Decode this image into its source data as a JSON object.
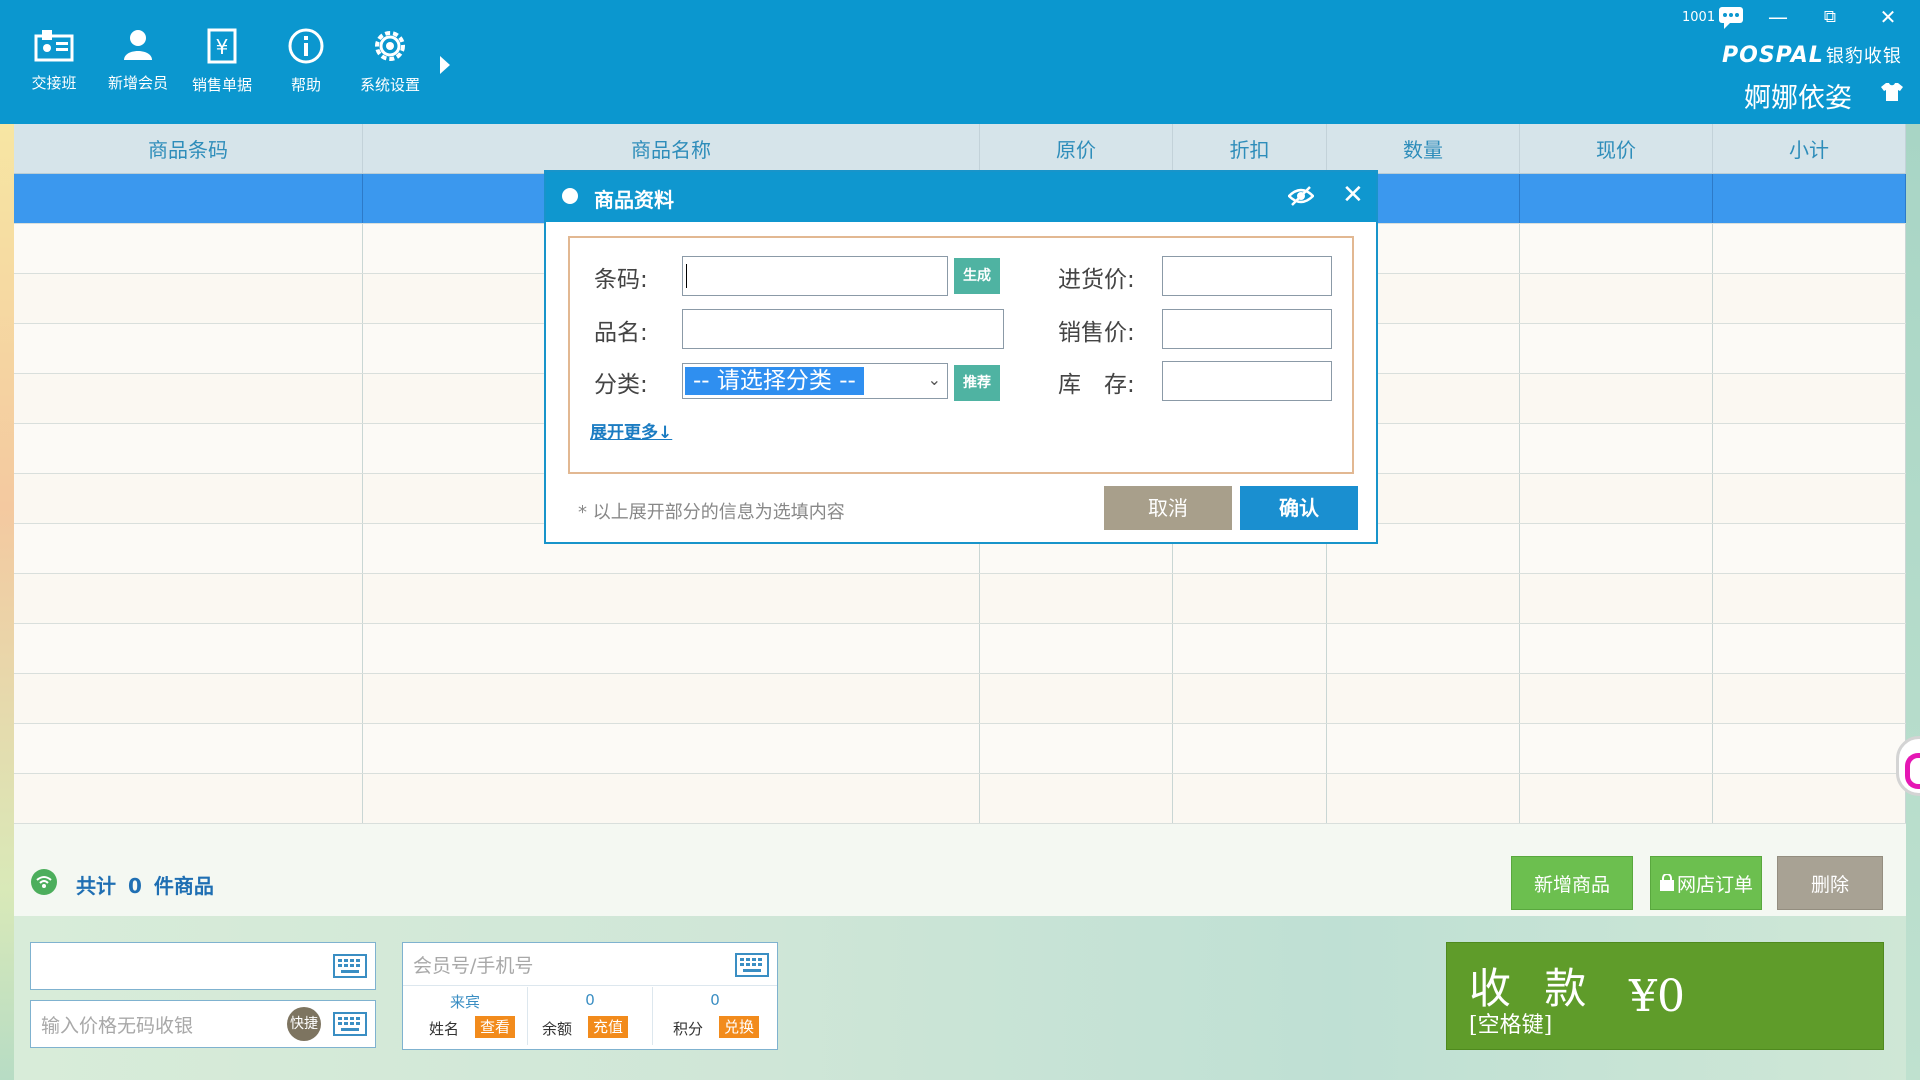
{
  "toolbar": {
    "items": [
      {
        "label": "交接班",
        "icon": "shift-handover-icon"
      },
      {
        "label": "新增会员",
        "icon": "add-member-icon"
      },
      {
        "label": "销售单据",
        "icon": "sales-receipt-icon"
      },
      {
        "label": "帮助",
        "icon": "help-icon"
      },
      {
        "label": "系统设置",
        "icon": "settings-icon"
      }
    ]
  },
  "window": {
    "account": "1001",
    "brand_logo": "POSPAL",
    "brand_sub": "银豹收银",
    "store_name": "婀娜依姿",
    "minimize": "—",
    "restore": "⧉",
    "close": "✕"
  },
  "table": {
    "columns": [
      "商品条码",
      "商品名称",
      "原价",
      "折扣",
      "数量",
      "现价",
      "小计"
    ],
    "row_count": 13
  },
  "summary": {
    "prefix": "共计",
    "count": "0",
    "suffix": "件商品",
    "btn_add_product": "新增商品",
    "btn_online_orders": "网店订单",
    "btn_delete": "删除"
  },
  "bottom": {
    "price_input_placeholder": "输入价格无码收银",
    "quick_badge": "快捷",
    "member_placeholder": "会员号/手机号",
    "member": {
      "name_value": "来宾",
      "name_label": "姓名",
      "name_tag": "查看",
      "balance_value": "0",
      "balance_label": "余额",
      "balance_tag": "充值",
      "points_value": "0",
      "points_label": "积分",
      "points_tag": "兑换"
    },
    "pay": {
      "label": "收 款",
      "hint": "[空格键]",
      "amount": "¥0"
    }
  },
  "modal": {
    "title": "商品资料",
    "barcode_label": "条码:",
    "barcode_value": "",
    "generate_btn": "生成",
    "name_label": "品名:",
    "name_value": "",
    "category_label": "分类:",
    "category_selected": "-- 请选择分类 --",
    "recommend_btn": "推荐",
    "purchase_price_label": "进货价:",
    "purchase_price_value": "",
    "sale_price_label": "销售价:",
    "sale_price_value": "",
    "stock_label": "库　存:",
    "stock_value": "",
    "expand_more": "展开更多↓",
    "note": "* 以上展开部分的信息为选填内容",
    "cancel": "取消",
    "confirm": "确认"
  },
  "colors": {
    "topbar": "#0b97cf",
    "accent_blue": "#1a8fd0",
    "green": "#6cbf4f",
    "pay_green": "#5f9c2a",
    "orange_tag": "#f28b1c"
  }
}
